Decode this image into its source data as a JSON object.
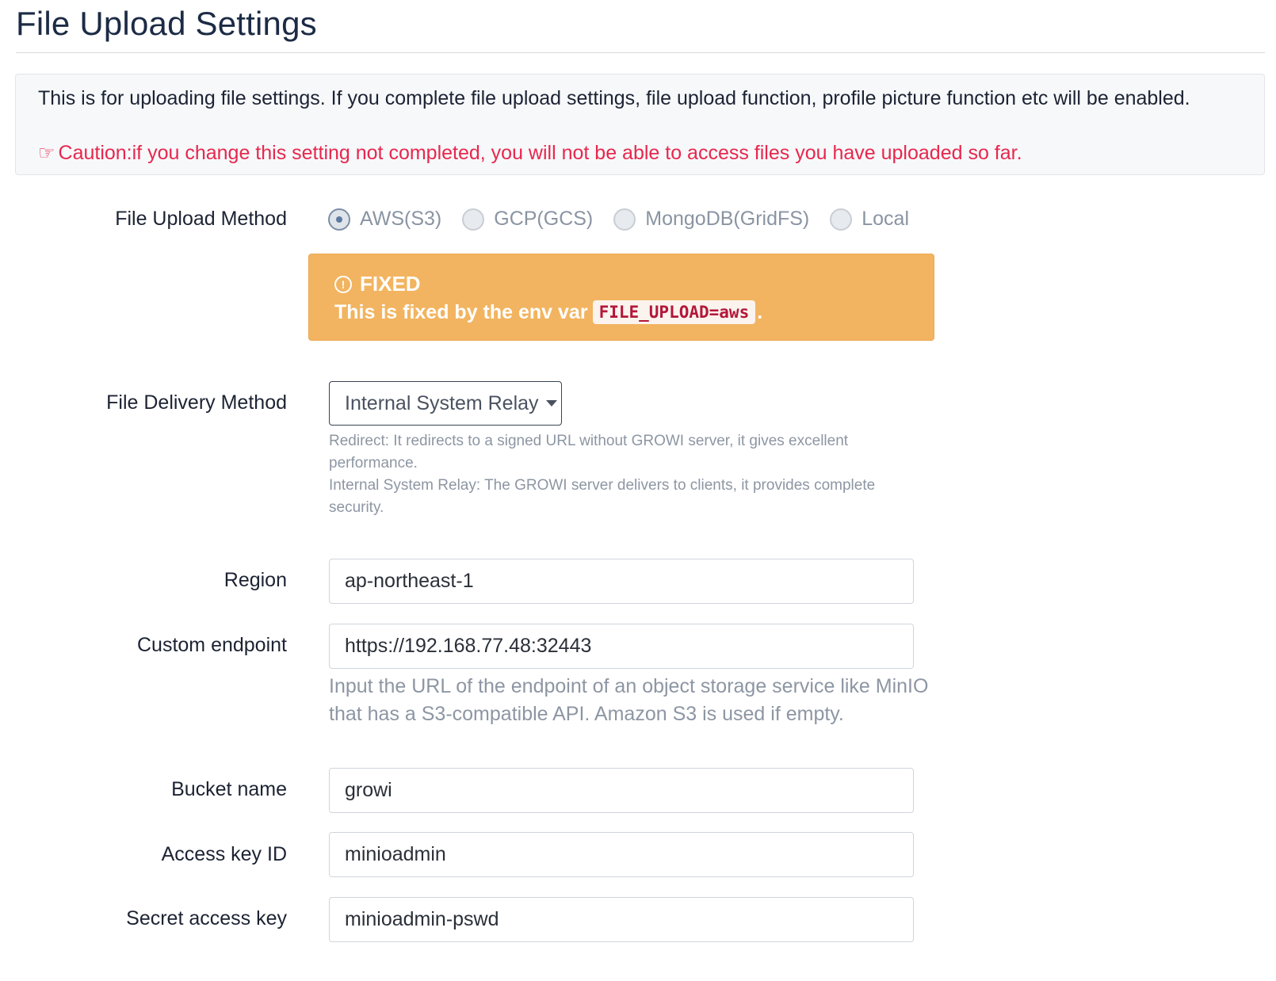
{
  "page": {
    "title": "File Upload Settings"
  },
  "info": {
    "description": "This is for uploading file settings. If you complete file upload settings, file upload function, profile picture function etc will be enabled.",
    "caution_icon": "caution-hand-icon",
    "caution": "Caution:if you change this setting not completed, you will not be able to access files you have uploaded so far.",
    "caution_color": "#e8274d"
  },
  "upload_method": {
    "label": "File Upload Method",
    "selected": "AWS(S3)",
    "options": [
      {
        "label": "AWS(S3)"
      },
      {
        "label": "GCP(GCS)"
      },
      {
        "label": "MongoDB(GridFS)"
      },
      {
        "label": "Local"
      }
    ]
  },
  "fixed_alert": {
    "icon": "info-circle-icon",
    "title": "FIXED",
    "message": "This is fixed by the env var",
    "env_var": "FILE_UPLOAD=aws",
    "suffix": ".",
    "color": "#f2b460"
  },
  "delivery_method": {
    "label": "File Delivery Method",
    "selected": "Internal System Relay",
    "help_redirect": "Redirect: It redirects to a signed URL without GROWI server, it gives excellent performance.",
    "help_relay": "Internal System Relay: The GROWI server delivers to clients, it provides complete security."
  },
  "region": {
    "label": "Region",
    "value": "ap-northeast-1"
  },
  "custom_endpoint": {
    "label": "Custom endpoint",
    "value": "https://192.168.77.48:32443",
    "help": "Input the URL of the endpoint of an object storage service like MinIO that has a S3-compatible API. Amazon S3 is used if empty."
  },
  "bucket_name": {
    "label": "Bucket name",
    "value": "growi"
  },
  "access_key_id": {
    "label": "Access key ID",
    "value": "minioadmin"
  },
  "secret_access_key": {
    "label": "Secret access key",
    "value": "minioadmin-pswd"
  }
}
